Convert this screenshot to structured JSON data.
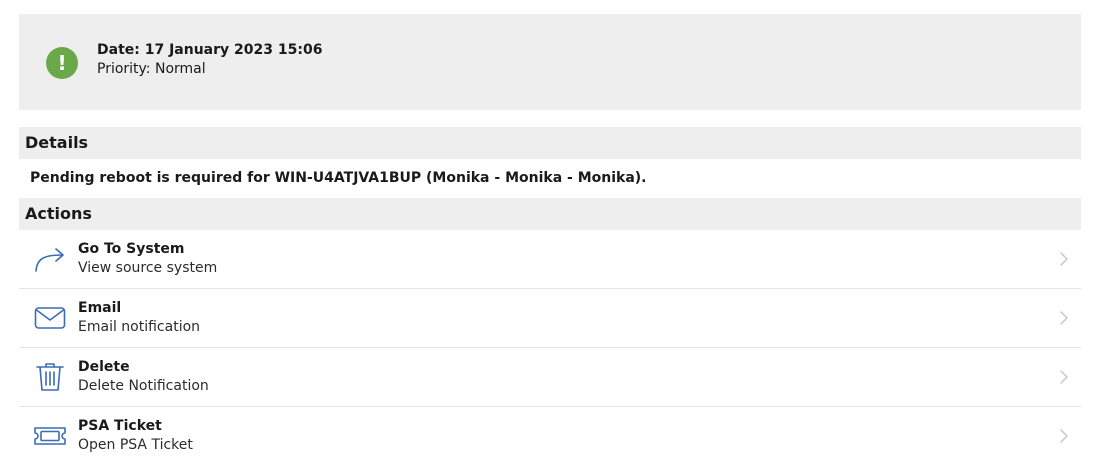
{
  "header": {
    "date": "Date: 17 January 2023 15:06",
    "priority": "Priority: Normal",
    "status_icon": "exclamation-icon",
    "status_glyph": "!",
    "status_color": "#6aa94a"
  },
  "details": {
    "heading": "Details",
    "message": "Pending reboot is required for WIN-U4ATJVA1BUP (Monika - Monika - Monika)."
  },
  "actions": {
    "heading": "Actions",
    "accent_color": "#3b6db3",
    "items": [
      {
        "title": "Go To System",
        "subtitle": "View source system",
        "icon": "share-arrow-icon"
      },
      {
        "title": "Email",
        "subtitle": "Email notification",
        "icon": "envelope-icon"
      },
      {
        "title": "Delete",
        "subtitle": "Delete Notification",
        "icon": "trash-icon"
      },
      {
        "title": "PSA Ticket",
        "subtitle": "Open PSA Ticket",
        "icon": "ticket-icon"
      }
    ]
  }
}
